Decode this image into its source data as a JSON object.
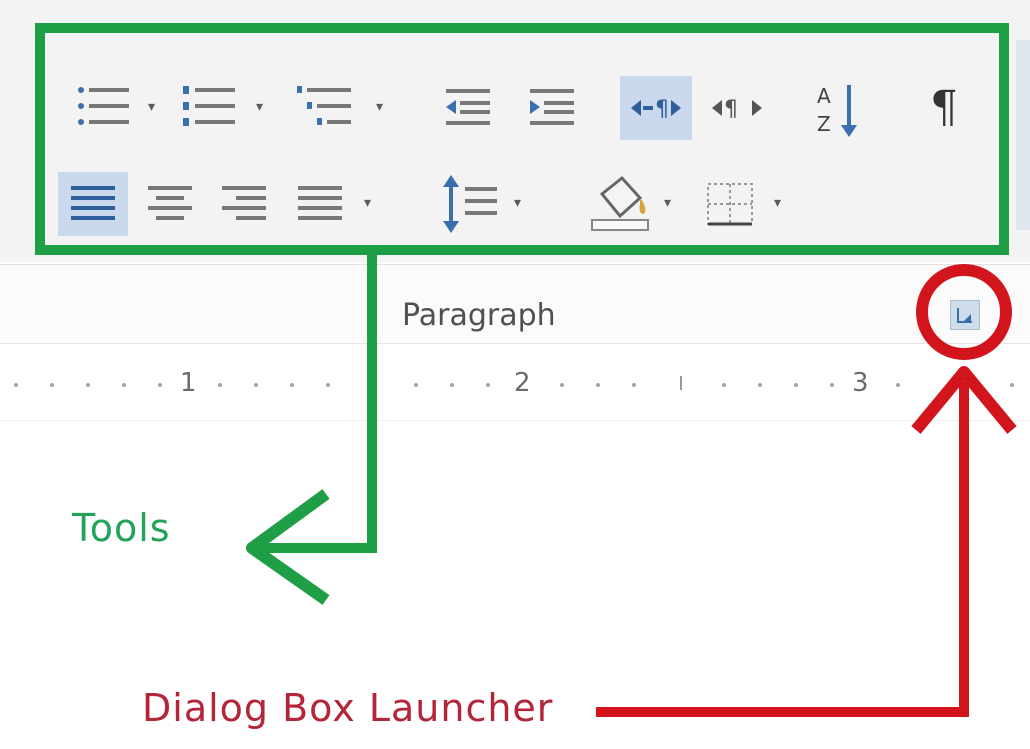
{
  "ribbon": {
    "group_label": "Paragraph",
    "row1": [
      {
        "name": "bullets-icon",
        "has_dropdown": true
      },
      {
        "name": "numbering-icon",
        "has_dropdown": true
      },
      {
        "name": "multilevel-list-icon",
        "has_dropdown": true
      },
      {
        "name": "decrease-indent-icon",
        "has_dropdown": false
      },
      {
        "name": "increase-indent-icon",
        "has_dropdown": false
      },
      {
        "name": "left-to-right-icon",
        "has_dropdown": false,
        "active": true
      },
      {
        "name": "right-to-left-icon",
        "has_dropdown": false
      },
      {
        "name": "sort-icon",
        "has_dropdown": false
      },
      {
        "name": "show-formatting-marks-icon",
        "has_dropdown": false
      }
    ],
    "row2": [
      {
        "name": "align-left-icon",
        "has_dropdown": false,
        "active": true
      },
      {
        "name": "align-center-icon",
        "has_dropdown": false
      },
      {
        "name": "align-right-icon",
        "has_dropdown": false
      },
      {
        "name": "justify-icon",
        "has_dropdown": true
      },
      {
        "name": "line-spacing-icon",
        "has_dropdown": true
      },
      {
        "name": "shading-icon",
        "has_dropdown": true
      },
      {
        "name": "borders-icon",
        "has_dropdown": true
      }
    ],
    "pilcrow_glyph": "¶",
    "dropdown_glyph": "▾"
  },
  "ruler": {
    "numbers": [
      "1",
      "2",
      "3"
    ]
  },
  "annotations": {
    "tools_label": "Tools",
    "tools_color": "#21a35a",
    "launcher_label": "Dialog Box Launcher",
    "launcher_color": "#b3263a",
    "frame_color": "#1e9e45",
    "arrow_red": "#d2141d"
  }
}
